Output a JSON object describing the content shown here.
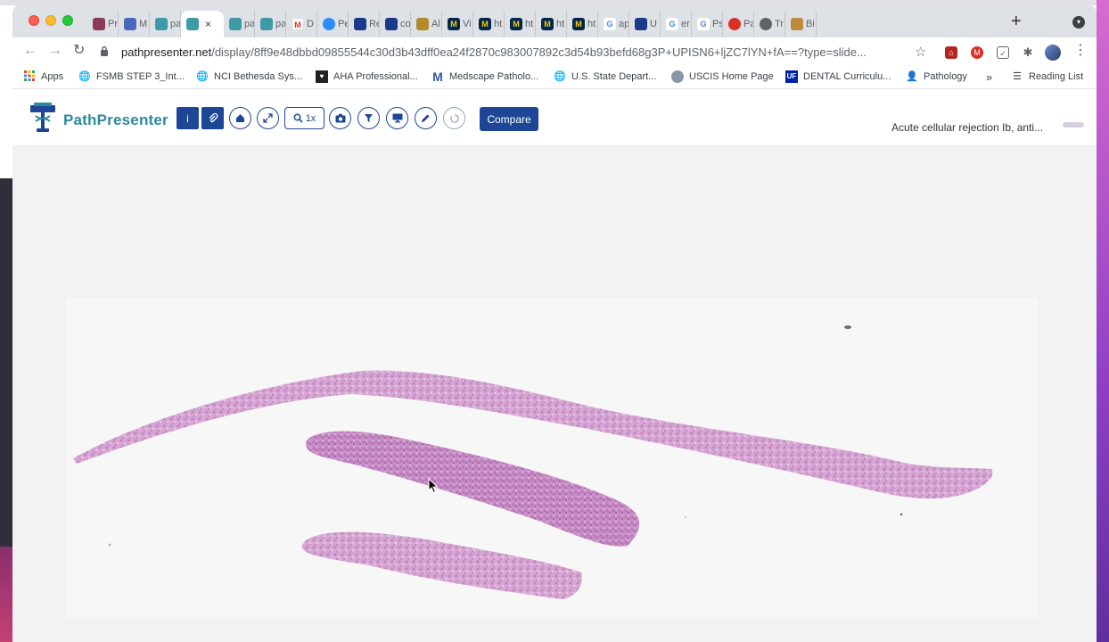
{
  "browser": {
    "tabs": [
      {
        "label": "Pr",
        "icon": "image-favicon"
      },
      {
        "label": "M",
        "icon": "teams-favicon"
      },
      {
        "label": "pa",
        "icon": "pathpresenter-favicon"
      },
      {
        "label": "",
        "icon": "pathpresenter-favicon",
        "active": true
      },
      {
        "label": "pa",
        "icon": "pathpresenter-favicon"
      },
      {
        "label": "pa",
        "icon": "pathpresenter-favicon"
      },
      {
        "label": "D",
        "icon": "gmail-favicon"
      },
      {
        "label": "Pe",
        "icon": "zoom-favicon"
      },
      {
        "label": "Re",
        "icon": "journal-favicon"
      },
      {
        "label": "co",
        "icon": "journal-favicon"
      },
      {
        "label": "Al",
        "icon": "folder-favicon"
      },
      {
        "label": "Vi",
        "icon": "michigan-favicon"
      },
      {
        "label": "ht",
        "icon": "michigan-favicon"
      },
      {
        "label": "ht",
        "icon": "michigan-favicon"
      },
      {
        "label": "ht",
        "icon": "michigan-favicon"
      },
      {
        "label": "ht",
        "icon": "michigan-favicon"
      },
      {
        "label": "ap",
        "icon": "google-favicon"
      },
      {
        "label": "U",
        "icon": "journal-favicon"
      },
      {
        "label": "er",
        "icon": "google-favicon"
      },
      {
        "label": "Ps",
        "icon": "google-favicon"
      },
      {
        "label": "Pa",
        "icon": "settings-favicon"
      },
      {
        "label": "Tr",
        "icon": "globe-favicon"
      },
      {
        "label": "Bi",
        "icon": "image-favicon"
      }
    ],
    "active_tab_close": "×",
    "new_tab": "+",
    "url_host": "pathpresenter.net",
    "url_path": "/display/8ff9e48dbbd09855544c30d3b43dff0ea24f2870c983007892c3d54b93befd68g3P+UPISN6+ljZC7lYN+fA==?type=slide...",
    "bookmarks": [
      {
        "label": "Apps",
        "icon": "apps-grid-icon"
      },
      {
        "label": "FSMB STEP 3_Int...",
        "icon": "globe-icon"
      },
      {
        "label": "NCI Bethesda Sys...",
        "icon": "globe-icon"
      },
      {
        "label": "AHA Professional...",
        "icon": "aha-icon"
      },
      {
        "label": "Medscape Patholo...",
        "icon": "medscape-icon"
      },
      {
        "label": "U.S. State Depart...",
        "icon": "globe-icon"
      },
      {
        "label": "USCIS Home Page",
        "icon": "uscis-icon"
      },
      {
        "label": "DENTAL Curriculu...",
        "icon": "uf-icon"
      },
      {
        "label": "Pathology",
        "icon": "person-icon"
      }
    ],
    "bookmarks_overflow": "»",
    "reading_list": "Reading List"
  },
  "app": {
    "logo_text": "PathPresenter",
    "zoom_label": "1x",
    "compare_label": "Compare",
    "case_title": "Acute cellular rejection Ib, anti...",
    "toolbar_icons": [
      "info-icon",
      "paperclip-icon",
      "home-icon",
      "expand-icon",
      "zoom-icon",
      "camera-icon",
      "filter-icon",
      "monitor-icon",
      "pencil-icon",
      "lasso-icon"
    ]
  },
  "colors": {
    "brand_blue": "#1d4796",
    "brand_teal": "#2e8a9a",
    "tissue_pink": "#c890c8"
  }
}
